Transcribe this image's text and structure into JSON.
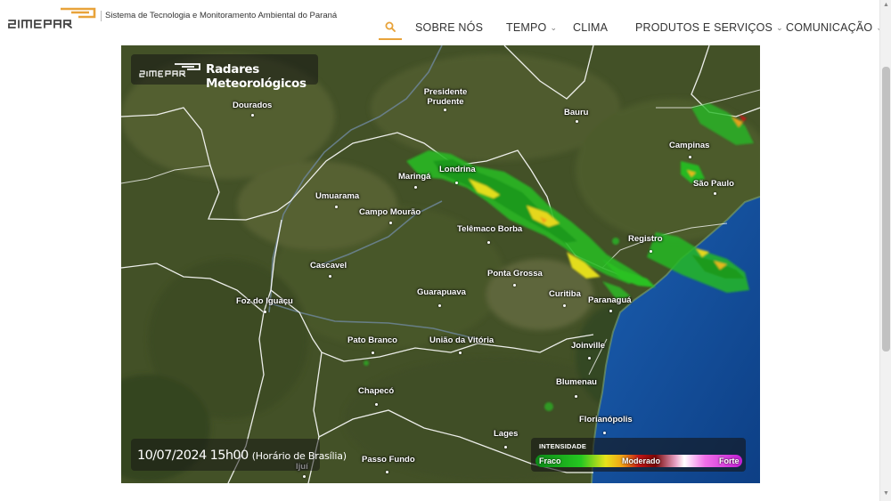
{
  "header": {
    "logo_text": "SIMEPAR",
    "tagline": "Sistema de Tecnologia e Monitoramento Ambiental do Paraná",
    "nav": [
      {
        "label": "SOBRE NÓS",
        "has_dropdown": false
      },
      {
        "label": "TEMPO",
        "has_dropdown": true
      },
      {
        "label": "CLIMA",
        "has_dropdown": false
      },
      {
        "label": "PRODUTOS E SERVIÇOS",
        "has_dropdown": true
      },
      {
        "label": "COMUNICAÇÃO",
        "has_dropdown": true
      }
    ],
    "search_icon": "search-icon",
    "accent_color": "#e8a33a"
  },
  "map": {
    "title": "Radares Meteorológicos",
    "title_logo": "SIMEPAR",
    "timestamp": "10/07/2024 15h00",
    "timezone": "(Horário de Brasília)",
    "cities": [
      "Dourados",
      "Presidente Prudente",
      "Bauru",
      "Campinas",
      "São Paulo",
      "Londrina",
      "Maringá",
      "Umuarama",
      "Campo Mourão",
      "Telêmaco Borba",
      "Registro",
      "Cascavel",
      "Ponta Grossa",
      "Guarapuava",
      "Curitiba",
      "Paranaguá",
      "Foz do Iguaçu",
      "Pato Branco",
      "União da Vitória",
      "Joinville",
      "Blumenau",
      "Chapecó",
      "Florianópolis",
      "Lages",
      "Passo Fundo",
      "Ijuí"
    ],
    "legend": {
      "title": "INTENSIDADE",
      "low": "Fraco",
      "mid": "Moderado",
      "high": "Forte",
      "colors": [
        "#0c8a18",
        "#25c820",
        "#e7e31b",
        "#f1a215",
        "#c21616",
        "#e9a5c9",
        "#f06fe8",
        "#c21ed6"
      ]
    }
  }
}
